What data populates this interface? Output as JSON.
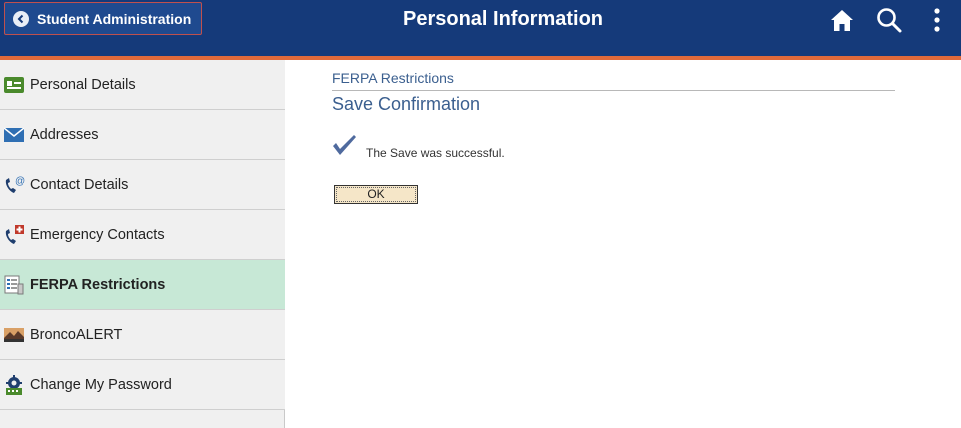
{
  "header": {
    "back_label": "Student Administration",
    "title": "Personal Information",
    "icons": [
      "home-icon",
      "search-icon",
      "more-vertical-icon"
    ],
    "colors": {
      "bar": "#153a7a",
      "stripe": "#e06a3b"
    }
  },
  "sidebar": {
    "items": [
      {
        "label": "Personal Details",
        "icon": "id-card-icon",
        "active": false
      },
      {
        "label": "Addresses",
        "icon": "envelope-icon",
        "active": false
      },
      {
        "label": "Contact Details",
        "icon": "phone-at-icon",
        "active": false
      },
      {
        "label": "Emergency Contacts",
        "icon": "phone-medical-icon",
        "active": false
      },
      {
        "label": "FERPA Restrictions",
        "icon": "document-list-icon",
        "active": true
      },
      {
        "label": "BroncoALERT",
        "icon": "alert-landscape-icon",
        "active": false
      },
      {
        "label": "Change My Password",
        "icon": "password-gear-icon",
        "active": false
      }
    ],
    "active_color": "#c7e8d6"
  },
  "main": {
    "section_sub": "FERPA Restrictions",
    "section_title": "Save Confirmation",
    "message": "The Save was successful.",
    "ok_label": "OK"
  }
}
